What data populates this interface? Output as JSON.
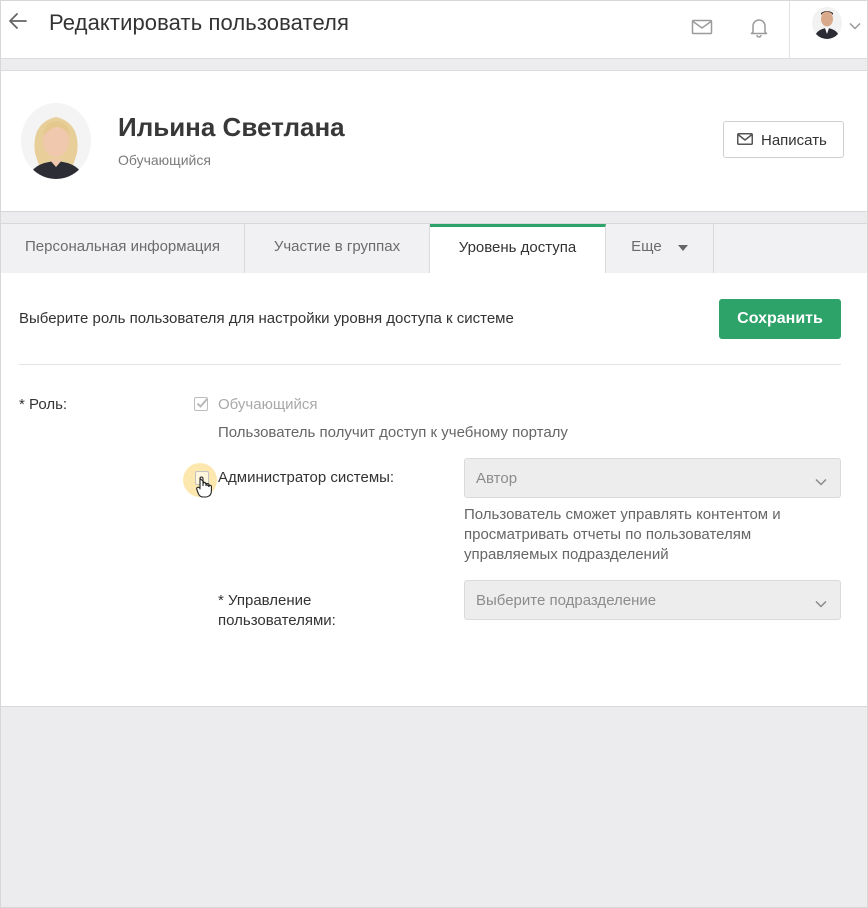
{
  "header": {
    "title": "Редактировать пользователя"
  },
  "profile": {
    "name": "Ильина Светлана",
    "role": "Обучающийся",
    "write_button": "Написать"
  },
  "tabs": [
    {
      "label": "Персональная информация",
      "active": false
    },
    {
      "label": "Участие в группах",
      "active": false
    },
    {
      "label": "Уровень доступа",
      "active": true
    },
    {
      "label": "Еще",
      "active": false
    }
  ],
  "access": {
    "intro": "Выберите роль пользователя для настройки уровня доступа к системе",
    "save_button": "Сохранить",
    "role_label": "* Роль:",
    "learner_option": {
      "label": "Обучающийся",
      "checked": true,
      "disabled": true
    },
    "learner_hint": "Пользователь получит доступ к учебному порталу",
    "admin_option": {
      "label": "Администратор системы:",
      "checked": false
    },
    "admin_select_value": "Автор",
    "admin_hint": "Пользователь сможет управлять контентом и просматривать отчеты по пользователям управляемых подразделений",
    "management_label": "* Управление пользователями:",
    "management_placeholder": "Выберите подразделение"
  },
  "colors": {
    "accent": "#2da36a",
    "background": "#ececee",
    "hover_highlight": "#fad66e"
  },
  "icons": [
    "back-arrow-icon",
    "mail-icon",
    "bell-icon",
    "chevron-down-icon",
    "envelope-icon",
    "caret-down-icon",
    "checkmark-icon",
    "hand-pointer-cursor-icon"
  ]
}
